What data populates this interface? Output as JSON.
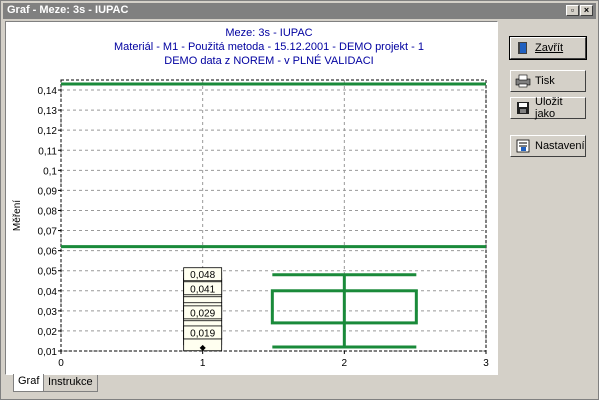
{
  "window": {
    "title": "Graf - Meze: 3s - IUPAC"
  },
  "chart_data": {
    "type": "scatter",
    "title_lines": [
      "Meze: 3s - IUPAC",
      "Materiál - M1 - Použitá metoda - 15.12.2001 - DEMO projekt - 1",
      "DEMO data z NOREM - v PLNÉ VALIDACI"
    ],
    "ylabel": "Měření",
    "xlabel": "",
    "xlim": [
      0,
      3
    ],
    "ylim": [
      0.01,
      0.145
    ],
    "x_ticks": [
      "0",
      "1",
      "2",
      "3"
    ],
    "y_ticks": [
      "0,01",
      "0,02",
      "0,03",
      "0,04",
      "0,05",
      "0,06",
      "0,07",
      "0,08",
      "0,09",
      "0,1",
      "0,11",
      "0,12",
      "0,13",
      "0,14"
    ],
    "grid": true,
    "limit_lines": [
      0.143,
      0.062
    ],
    "point_labels_x": 1,
    "point_labels": [
      {
        "y": 0.048,
        "label": "0,048"
      },
      {
        "y": 0.041,
        "label": "0,041"
      },
      {
        "y": 0.029,
        "label": "0,029"
      },
      {
        "y": 0.019,
        "label": "0,019"
      }
    ],
    "boxplot": {
      "x": 2,
      "min": 0.012,
      "q1": 0.024,
      "q3": 0.04,
      "max": 0.048,
      "whisker_top": 0.048,
      "whisker_bottom": 0.012
    },
    "line_color": "#1a8a3a"
  },
  "buttons": {
    "close": "Zavřít",
    "print": "Tisk",
    "save_as": "Uložit jako",
    "settings": "Nastavení"
  },
  "tabs": [
    "Graf",
    "Instrukce"
  ]
}
